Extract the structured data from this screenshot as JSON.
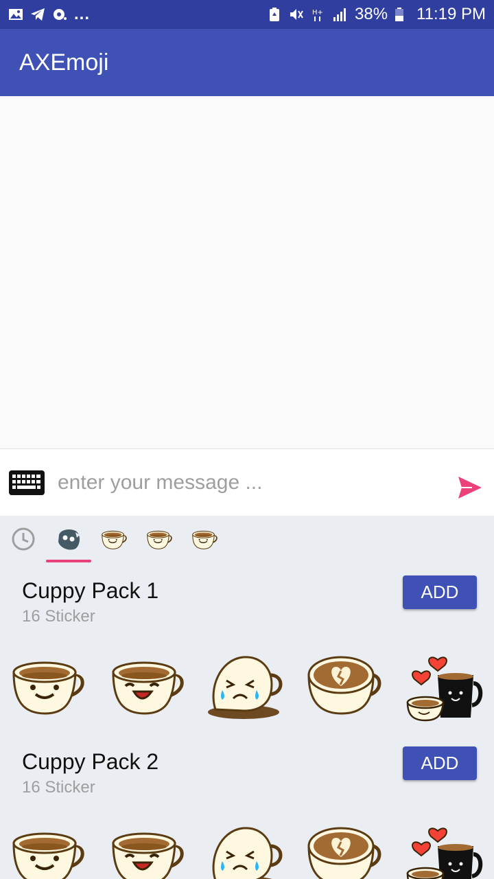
{
  "status_bar": {
    "left_icons": [
      "gallery-icon",
      "telegram-icon",
      "sync-icon"
    ],
    "more": "...",
    "right_icons": [
      "battery-saver-icon",
      "mute-icon",
      "network-hplus-icon",
      "signal-icon"
    ],
    "battery_percent": "38%",
    "time": "11:19 PM"
  },
  "app_bar": {
    "title": "AXEmoji"
  },
  "input_bar": {
    "placeholder": "enter your message ...",
    "value": "",
    "keyboard_icon": "keyboard-icon",
    "send_icon": "send-icon",
    "send_color": "#ec407a"
  },
  "sticker_tabs": [
    {
      "icon": "recent-clock-icon"
    },
    {
      "icon": "sticker-face-icon",
      "selected": true
    },
    {
      "icon": "cup-sticker-icon"
    },
    {
      "icon": "cup-sticker-icon"
    },
    {
      "icon": "cup-sticker-icon"
    }
  ],
  "packs": [
    {
      "title": "Cuppy Pack 1",
      "count": "16 Sticker",
      "add_label": "ADD",
      "stickers": [
        "cup-smile",
        "cup-laugh",
        "cup-crying-spill",
        "cup-latte-broken-heart",
        "cups-in-love"
      ]
    },
    {
      "title": "Cuppy Pack 2",
      "count": "16 Sticker",
      "add_label": "ADD",
      "stickers": [
        "cup-smile",
        "cup-laugh",
        "cup-crying-spill",
        "cup-latte-broken-heart",
        "cups-in-love"
      ]
    }
  ],
  "colors": {
    "status_bar": "#303f9f",
    "app_bar": "#3f51b5",
    "accent": "#ec407a",
    "panel_bg": "#eaedf2"
  }
}
